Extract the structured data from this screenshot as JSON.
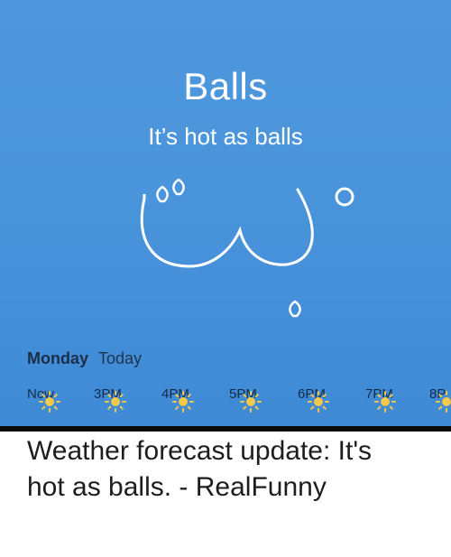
{
  "weather": {
    "city": "Balls",
    "condition": "It’s hot as balls",
    "day": "Monday",
    "today_label": "Today",
    "hours": [
      "Now",
      "3PM",
      "4PM",
      "5PM",
      "6PM",
      "7PM",
      "8P"
    ],
    "hour_icons": [
      "sun-icon",
      "sun-icon",
      "sun-icon",
      "sun-icon",
      "sun-icon",
      "sun-icon",
      "sun-icon"
    ],
    "colors": {
      "sky": "#4a94db",
      "sun": "#f2c94c",
      "text_dark": "#1b2f49"
    }
  },
  "caption": {
    "line1": "Weather forecast update: It's",
    "line2": "hot as balls. - RealFunny"
  }
}
